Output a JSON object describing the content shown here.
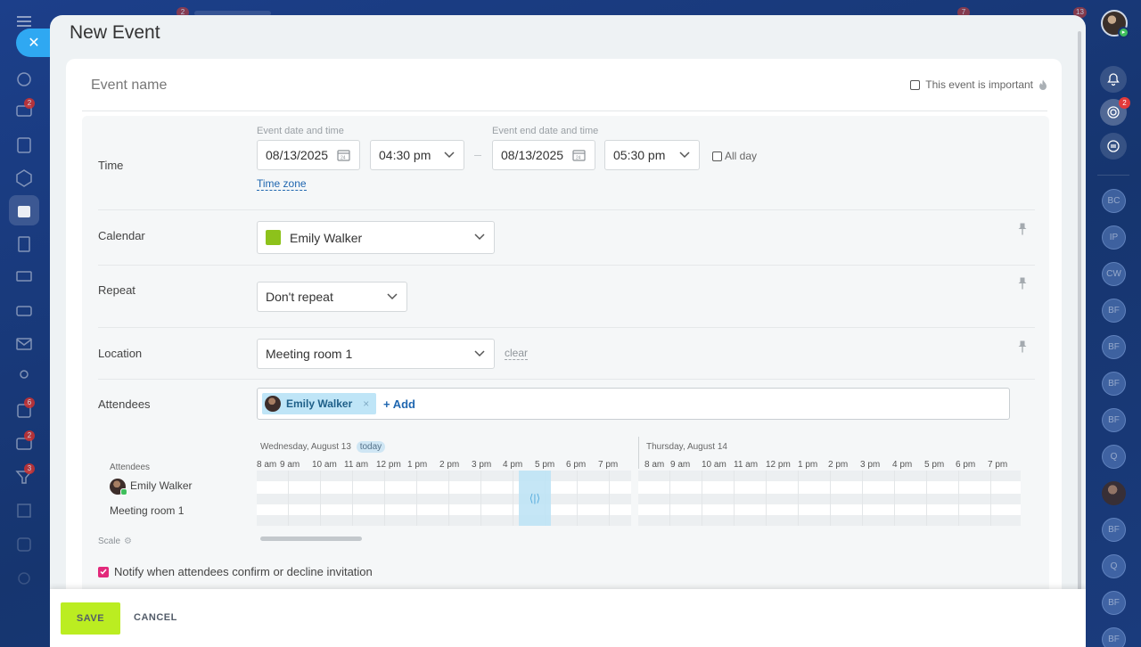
{
  "panel": {
    "title": "New Event"
  },
  "event": {
    "name_placeholder": "Event name",
    "important_label": "This event is important"
  },
  "time": {
    "label": "Time",
    "start_caption": "Event date and time",
    "end_caption": "Event end date and time",
    "start_date": "08/13/2025",
    "start_time": "04:30 pm",
    "end_date": "08/13/2025",
    "end_time": "05:30 pm",
    "all_day_label": "All day",
    "timezone_link": "Time zone"
  },
  "calendar": {
    "label": "Calendar",
    "value": "Emily Walker",
    "color": "#8dc21b"
  },
  "repeat": {
    "label": "Repeat",
    "value": "Don't repeat"
  },
  "location": {
    "label": "Location",
    "value": "Meeting room 1",
    "clear_link": "clear"
  },
  "attendees": {
    "label": "Attendees",
    "chips": [
      {
        "name": "Emily Walker",
        "remove_icon": "×"
      }
    ],
    "add_link": "+ Add"
  },
  "planner": {
    "day1": {
      "title": "Wednesday, August 13",
      "badge": "today"
    },
    "day2": {
      "title": "Thursday, August 14"
    },
    "hours_day1": [
      "8 am",
      "9 am",
      "10 am",
      "11 am",
      "12 pm",
      "1 pm",
      "2 pm",
      "3 pm",
      "4 pm",
      "5 pm",
      "6 pm",
      "7 pm"
    ],
    "hours_day2": [
      "8 am",
      "9 am",
      "10 am",
      "11 am",
      "12 pm",
      "1 pm",
      "2 pm",
      "3 pm",
      "4 pm",
      "5 pm",
      "6 pm",
      "7 pm"
    ],
    "side_title": "Attendees",
    "rows": [
      "Emily Walker",
      "Meeting room 1"
    ],
    "scale_label": "Scale"
  },
  "notify": {
    "label": "Notify when attendees confirm or decline invitation",
    "checked": true
  },
  "footer": {
    "save": "SAVE",
    "cancel": "CANCEL"
  },
  "right_rail": {
    "badge_count": "2",
    "contacts": [
      "BC",
      "IP",
      "CW",
      "BF",
      "BF",
      "BF",
      "BF",
      "Q",
      "",
      "BF",
      "Q",
      "BF",
      "BF"
    ]
  },
  "left_rail": {
    "badges": [
      "2",
      "6",
      "2",
      "3"
    ]
  },
  "top_badges": [
    "2",
    "7",
    "13"
  ],
  "colors": {
    "accent": "#2fa8f2",
    "save_button": "#bbed21",
    "link": "#2067b0",
    "checkbox_on": "#e2297b"
  }
}
